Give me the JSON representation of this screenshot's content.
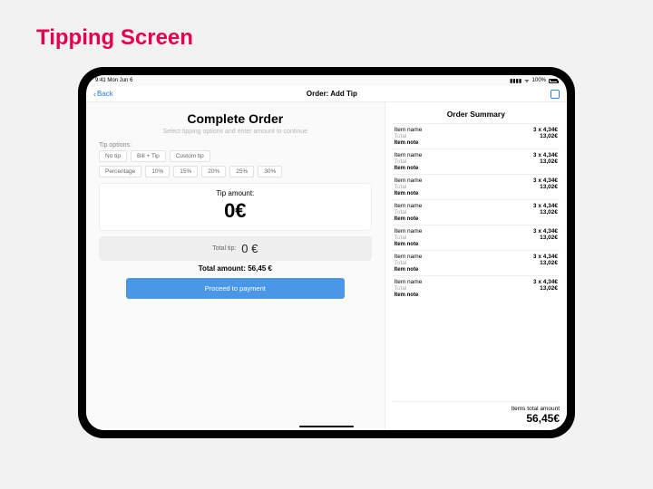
{
  "page_heading": "Tipping Screen",
  "status": {
    "time": "9:41 Mon Jun 6",
    "signal": "▮▮▮▮",
    "wifi": "✦",
    "battery_pct": "100%"
  },
  "nav": {
    "back": "Back",
    "title": "Order: Add Tip"
  },
  "main": {
    "title": "Complete Order",
    "subtitle": "Select tipping options and enter amount to continue",
    "tip_options_label": "Tip options:",
    "tip_options_row1": [
      "No tip",
      "Bill + Tip",
      "Custom tip"
    ],
    "tip_options_row2": [
      "Percentage",
      "10%",
      "15%",
      "20%",
      "25%",
      "30%"
    ],
    "tip_amount_label": "Tip amount:",
    "tip_amount_value": "0€",
    "total_tip_label": "Total tip:",
    "total_tip_value": "0 €",
    "total_amount_label": "Total amount:",
    "total_amount_value": "56,45 €",
    "proceed_label": "Proceed to payment"
  },
  "summary": {
    "title": "Order Summary",
    "items": [
      {
        "name": "Item name",
        "qty_price": "3 x 4,34€",
        "total_lbl": "Total",
        "subtotal": "13,02€",
        "note": "Item note"
      },
      {
        "name": "Item name",
        "qty_price": "3 x 4,34€",
        "total_lbl": "Total",
        "subtotal": "13,02€",
        "note": "Item note"
      },
      {
        "name": "Item name",
        "qty_price": "3 x 4,34€",
        "total_lbl": "Total",
        "subtotal": "13,02€",
        "note": "Item note"
      },
      {
        "name": "Item name",
        "qty_price": "3 x 4,34€",
        "total_lbl": "Total",
        "subtotal": "13,02€",
        "note": "Item note"
      },
      {
        "name": "Item name",
        "qty_price": "3 x 4,34€",
        "total_lbl": "Total",
        "subtotal": "13,02€",
        "note": "Item note"
      },
      {
        "name": "Item name",
        "qty_price": "3 x 4,34€",
        "total_lbl": "Total",
        "subtotal": "13,02€",
        "note": "Item note"
      },
      {
        "name": "Item name",
        "qty_price": "3 x 4,34€",
        "total_lbl": "Total",
        "subtotal": "13,02€",
        "note": "Item note"
      }
    ],
    "footer_label": "Items total amount",
    "footer_value": "56,45€"
  }
}
